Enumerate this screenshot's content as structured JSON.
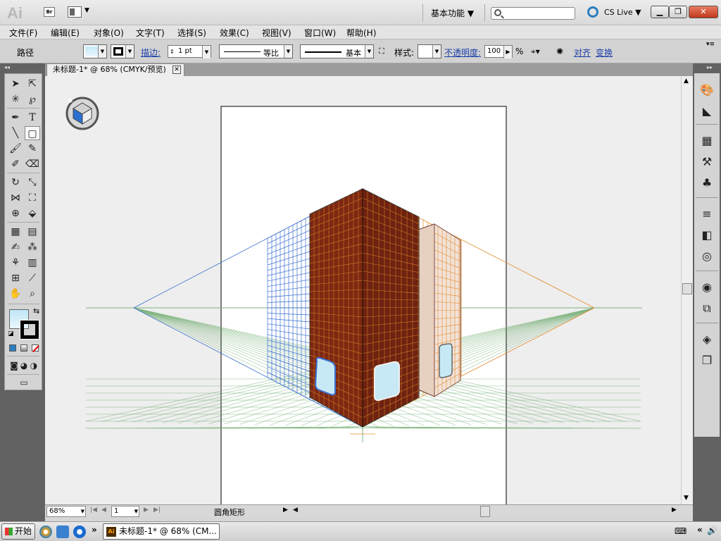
{
  "titlebar": {
    "app_logo": "Ai",
    "bridge_label": "Br",
    "workspace": "基本功能 ▼",
    "search_placeholder": "",
    "cslive": "CS Live ▼",
    "min_label": "▁",
    "max_label": "❐",
    "close_label": "✕"
  },
  "menu": {
    "items": [
      "文件(F)",
      "编辑(E)",
      "对象(O)",
      "文字(T)",
      "选择(S)",
      "效果(C)",
      "视图(V)",
      "窗口(W)",
      "帮助(H)"
    ]
  },
  "controlbar": {
    "object_type": "路径",
    "stroke_label": "描边:",
    "stroke_weight": "1 pt",
    "profile_label": "等比",
    "brush_label": "基本",
    "style_label": "样式:",
    "opacity_label": "不透明度:",
    "opacity_value": "100",
    "opacity_unit": "%",
    "align_label": "对齐",
    "transform_label": "变换"
  },
  "document": {
    "tab_title": "未标题-1* @ 68% (CMYK/预览)",
    "tab_close": "✕"
  },
  "statusbar": {
    "zoom": "68%",
    "page": "1",
    "current_tool": "圆角矩形"
  },
  "taskbar": {
    "start_label": "开始",
    "task_item": "未标题-1* @ 68% (CM...",
    "ai_icon": "Ai",
    "overflow": "»"
  },
  "colors": {
    "building_face_left": "#8b2a12",
    "building_face_right": "#7a2410",
    "grid_left": "#3a6fd0",
    "grid_right": "#e48a2a",
    "grid_ground": "#4a9a4a",
    "window_fill": "#c7e8f5"
  },
  "icons": {
    "tools": [
      "selection-icon",
      "direct-selection-icon",
      "magic-wand-icon",
      "lasso-icon",
      "pen-icon",
      "type-icon",
      "line-icon",
      "rounded-rectangle-icon",
      "paintbrush-icon",
      "pencil-icon",
      "blob-brush-icon",
      "eraser-icon",
      "rotate-icon",
      "scale-icon",
      "width-icon",
      "free-transform-icon",
      "shape-builder-icon",
      "perspective-grid-icon",
      "mesh-icon",
      "gradient-icon",
      "eyedropper-icon",
      "blend-icon",
      "symbol-sprayer-icon",
      "column-graph-icon",
      "artboard-icon",
      "slice-icon",
      "hand-icon",
      "zoom-icon"
    ]
  }
}
